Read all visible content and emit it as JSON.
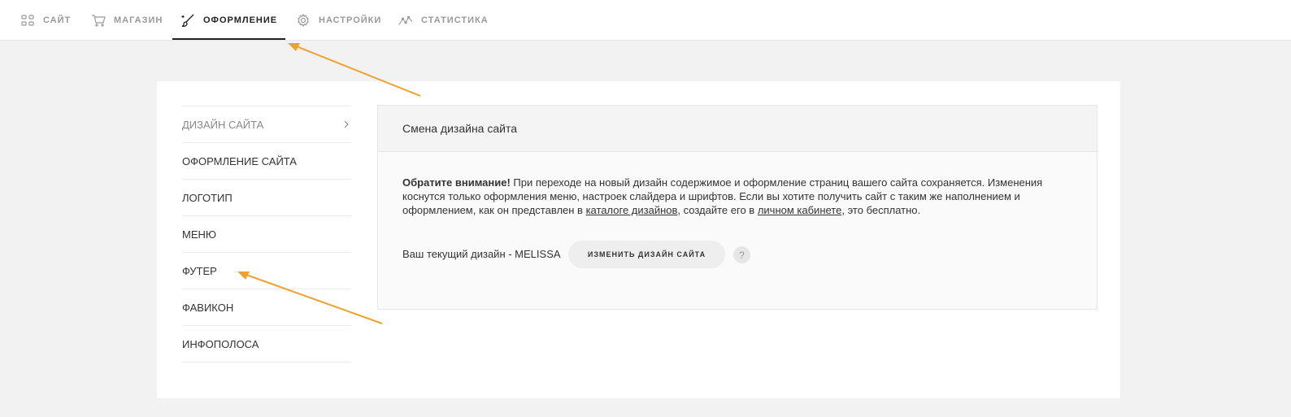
{
  "nav": {
    "items": [
      {
        "label": "САЙТ",
        "icon": "grid-icon"
      },
      {
        "label": "МАГАЗИН",
        "icon": "cart-icon"
      },
      {
        "label": "ОФОРМЛЕНИЕ",
        "icon": "brush-icon",
        "active": true
      },
      {
        "label": "НАСТРОЙКИ",
        "icon": "gear-icon"
      },
      {
        "label": "СТАТИСТИКА",
        "icon": "chart-line-icon"
      }
    ]
  },
  "sidebar": {
    "items": [
      {
        "label": "ДИЗАЙН САЙТА",
        "active": true
      },
      {
        "label": "ОФОРМЛЕНИЕ САЙТА"
      },
      {
        "label": "ЛОГОТИП"
      },
      {
        "label": "МЕНЮ"
      },
      {
        "label": "ФУТЕР"
      },
      {
        "label": "ФАВИКОН"
      },
      {
        "label": "ИНФОПОЛОСА"
      }
    ]
  },
  "panel": {
    "title": "Смена дизайна сайта",
    "notice_bold": "Обратите внимание!",
    "notice_text1": " При переходе на новый дизайн содержимое и оформление страниц вашего сайта сохраняется. Изменения коснутся только оформления меню, настроек слайдера и шрифтов. Если вы хотите получить сайт с таким же наполнением и оформлением, как он представлен в ",
    "notice_link1": "каталоге дизайнов",
    "notice_text2": ", создайте его в ",
    "notice_link2": "личном кабинете",
    "notice_text3": ", это бесплатно.",
    "current_design": "Ваш текущий дизайн - MELISSA",
    "change_button": "ИЗМЕНИТЬ ДИЗАЙН САЙТА",
    "help": "?"
  },
  "colors": {
    "arrow": "#f0a030",
    "background": "#f2f2f2",
    "active_nav": "#222222"
  }
}
